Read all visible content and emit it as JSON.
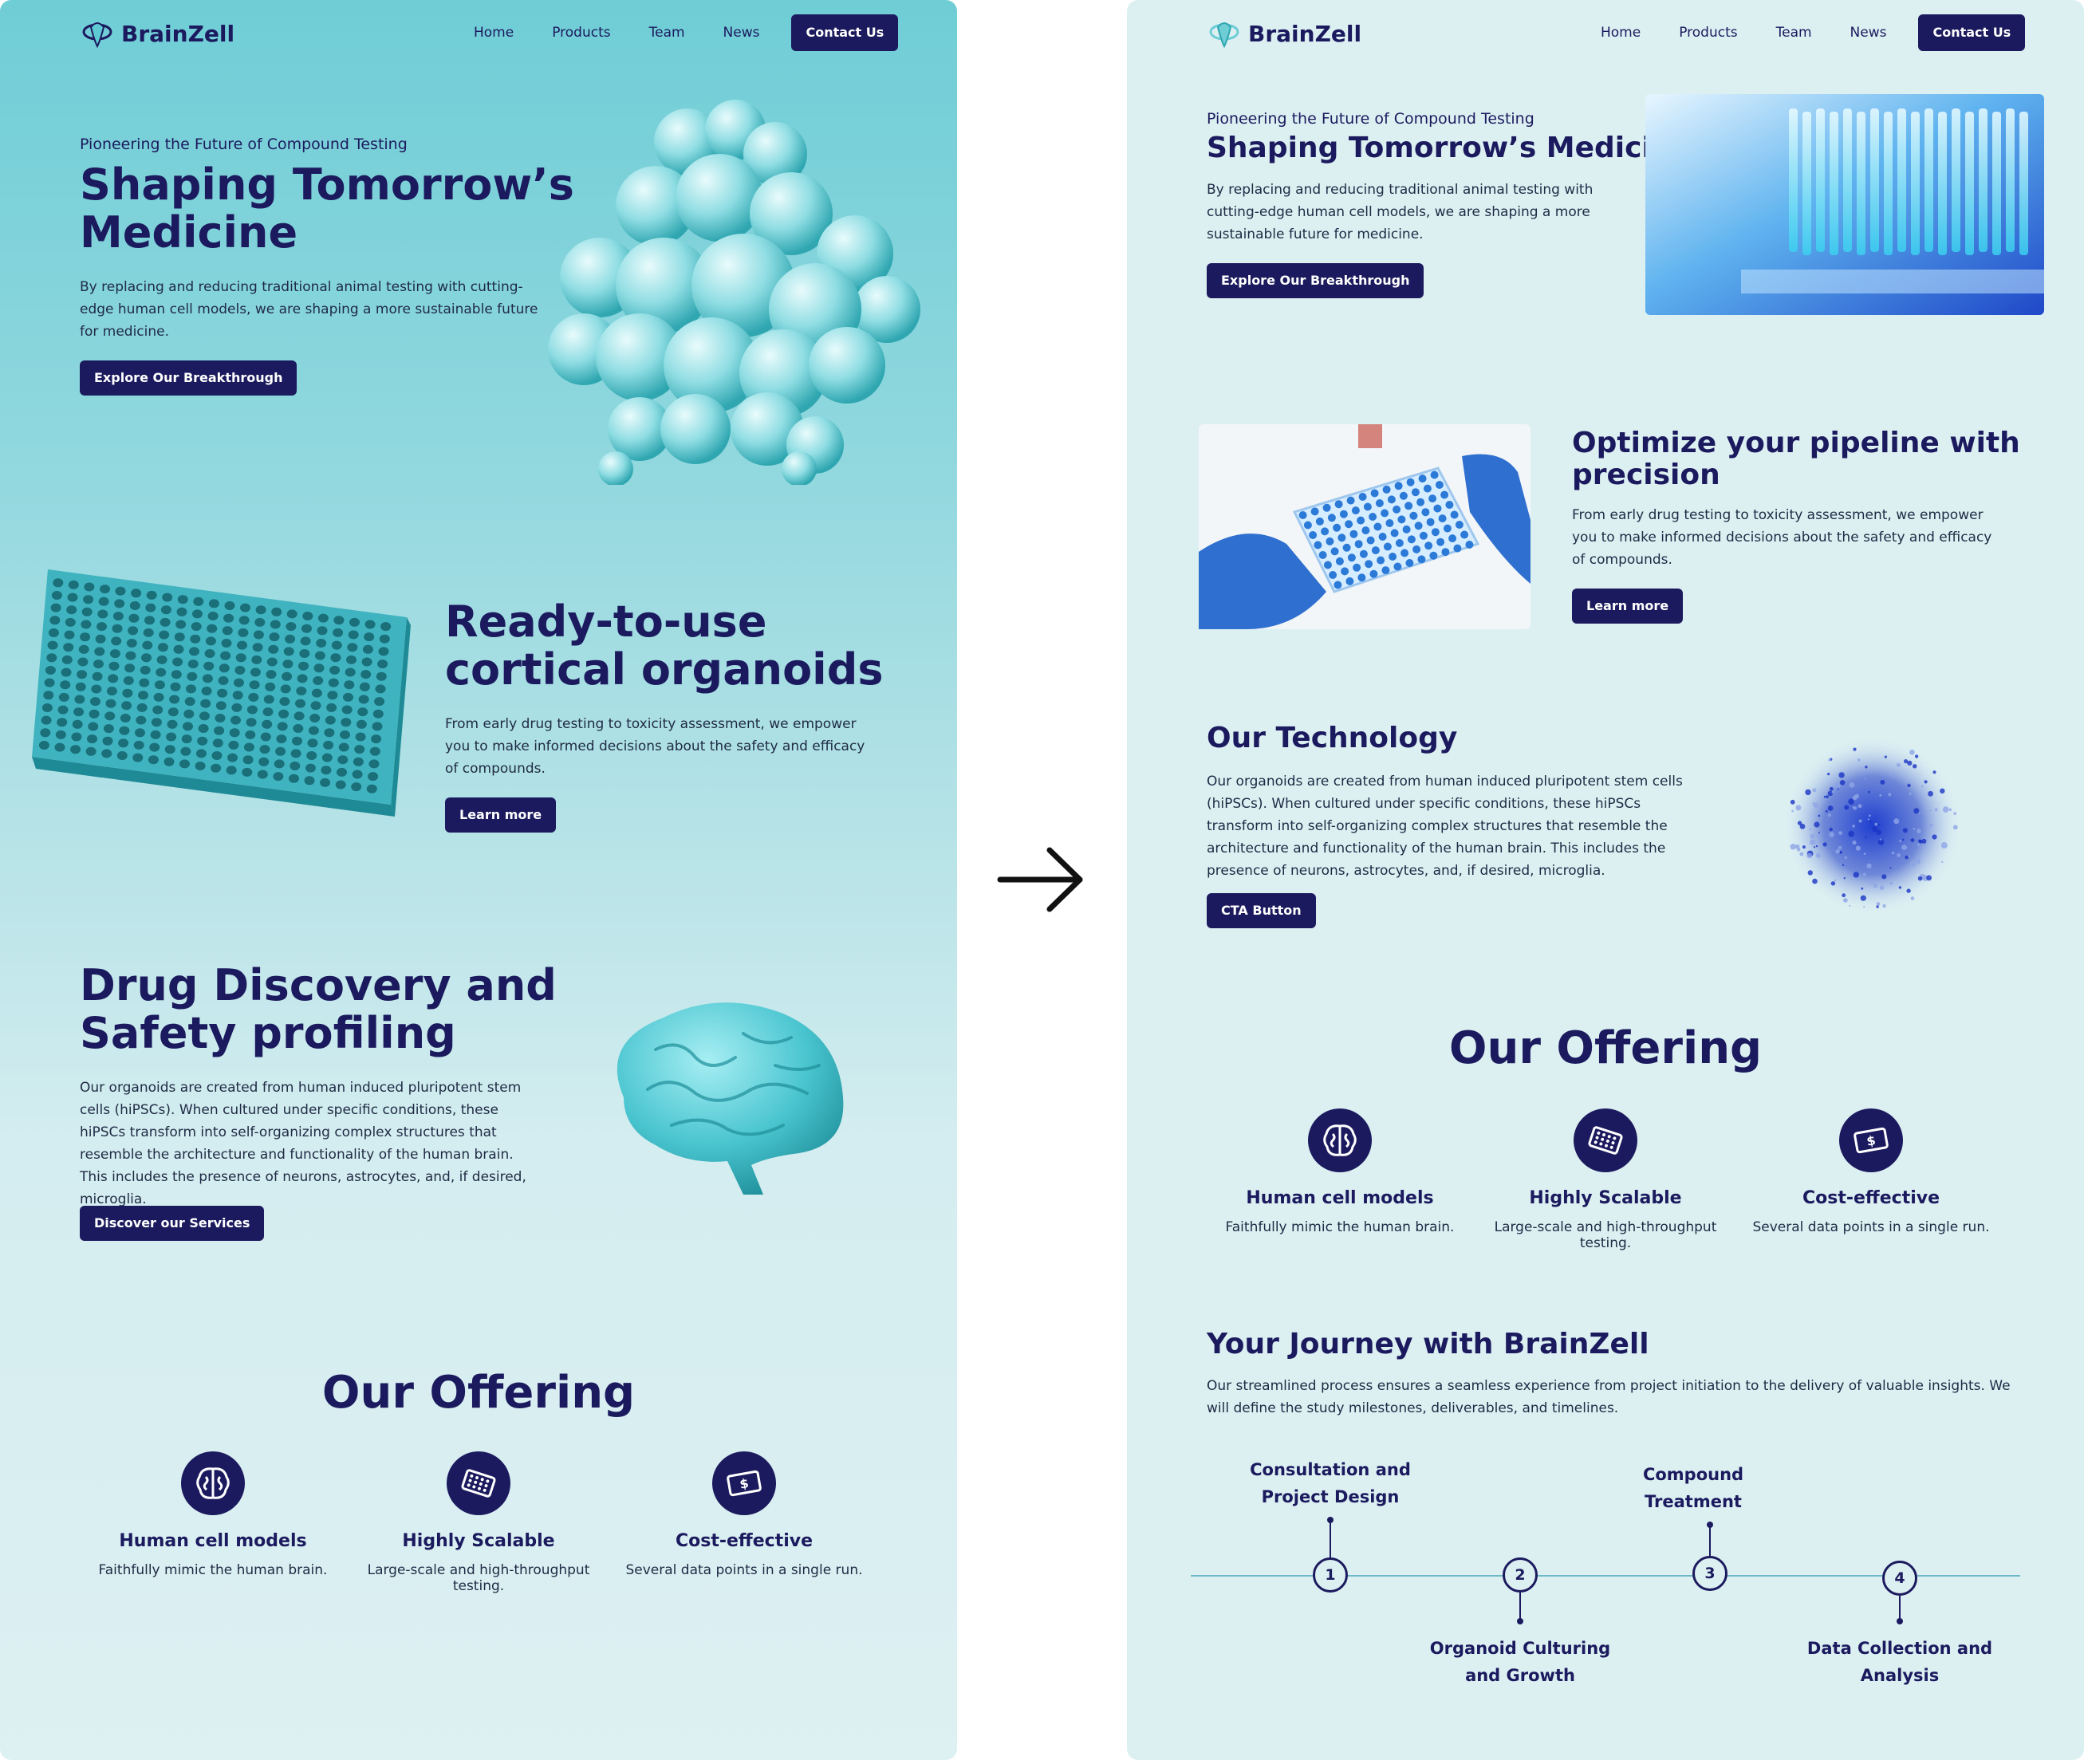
{
  "brand": {
    "name": "BrainZell",
    "accent": "#1b1a5e",
    "teal": "#6fcdd6"
  },
  "nav": {
    "items": [
      "Home",
      "Products",
      "Team",
      "News"
    ],
    "contact": "Contact Us"
  },
  "transition_icon": "arrow-right-icon",
  "left": {
    "hero": {
      "kicker": "Pioneering the Future of Compound Testing",
      "title_line1": "Shaping Tomorrow’s",
      "title_line2": "Medicine",
      "body": "By replacing and reducing traditional animal testing with cutting-edge human cell models, we are shaping a more sustainable future for medicine.",
      "cta": "Explore Our Breakthrough",
      "image": "protein-molecule-3d"
    },
    "organoids": {
      "title_line1": "Ready-to-use",
      "title_line2": "cortical organoids",
      "body": "From early drug testing to toxicity assessment, we empower you to make informed decisions about the safety and efficacy of compounds.",
      "cta": "Learn more",
      "image": "well-plate-3d"
    },
    "discovery": {
      "title_line1": "Drug Discovery and",
      "title_line2": "Safety profiling",
      "body": "Our organoids are created from human induced pluripotent stem cells (hiPSCs). When cultured under specific conditions, these hiPSCs transform into self-organizing complex structures that resemble the architecture and functionality of the human brain. This includes the presence of neurons, astrocytes, and, if desired, microglia.",
      "cta": "Discover our Services",
      "image": "brain-3d"
    },
    "offering": {
      "title": "Our Offering",
      "items": [
        {
          "icon": "brain-icon",
          "title": "Human cell models",
          "desc": "Faithfully mimic the human brain."
        },
        {
          "icon": "well-plate-icon",
          "title": "Highly Scalable",
          "desc": "Large-scale and high-throughput testing."
        },
        {
          "icon": "money-icon",
          "title": "Cost-effective",
          "desc": "Several data points in a single run."
        }
      ]
    }
  },
  "right": {
    "hero": {
      "kicker": "Pioneering the Future of Compound Testing",
      "title": "Shaping Tomorrow’s Medicine",
      "body": "By replacing and reducing traditional animal testing with cutting-edge human cell models, we are shaping a more sustainable future for medicine.",
      "cta": "Explore Our Breakthrough",
      "image": "lab-tubes-photo"
    },
    "pipeline": {
      "title_line1": "Optimize your pipeline with",
      "title_line2": "precision",
      "body": "From early drug testing to toxicity assessment, we empower you to make informed decisions about the safety and efficacy of compounds.",
      "cta": "Learn more",
      "image": "gloved-hands-well-plate-photo"
    },
    "technology": {
      "title": "Our Technology",
      "body": "Our organoids are created from human induced pluripotent stem cells (hiPSCs). When cultured under specific conditions, these hiPSCs transform into self-organizing complex structures that resemble the architecture and functionality of the human brain. This includes the presence of neurons, astrocytes, and, if desired, microglia.",
      "cta": "CTA Button",
      "image": "organoid-microscopy"
    },
    "offering": {
      "title": "Our Offering",
      "items": [
        {
          "icon": "brain-icon",
          "title": "Human cell models",
          "desc": "Faithfully mimic the human brain."
        },
        {
          "icon": "well-plate-icon",
          "title": "Highly Scalable",
          "desc": "Large-scale and high-throughput testing."
        },
        {
          "icon": "money-icon",
          "title": "Cost-effective",
          "desc": "Several data points in a single run."
        }
      ]
    },
    "journey": {
      "title": "Your Journey with BrainZell",
      "body": "Our streamlined process ensures a seamless experience from project initiation to the delivery of valuable insights. We will define the study milestones, deliverables, and timelines.",
      "steps": [
        {
          "num": "1",
          "line1": "Consultation and",
          "line2": "Project Design"
        },
        {
          "num": "2",
          "line1": "Organoid Culturing",
          "line2": "and Growth"
        },
        {
          "num": "3",
          "line1": "Compound",
          "line2": "Treatment"
        },
        {
          "num": "4",
          "line1": "Data Collection and",
          "line2": "Analysis"
        }
      ]
    }
  }
}
